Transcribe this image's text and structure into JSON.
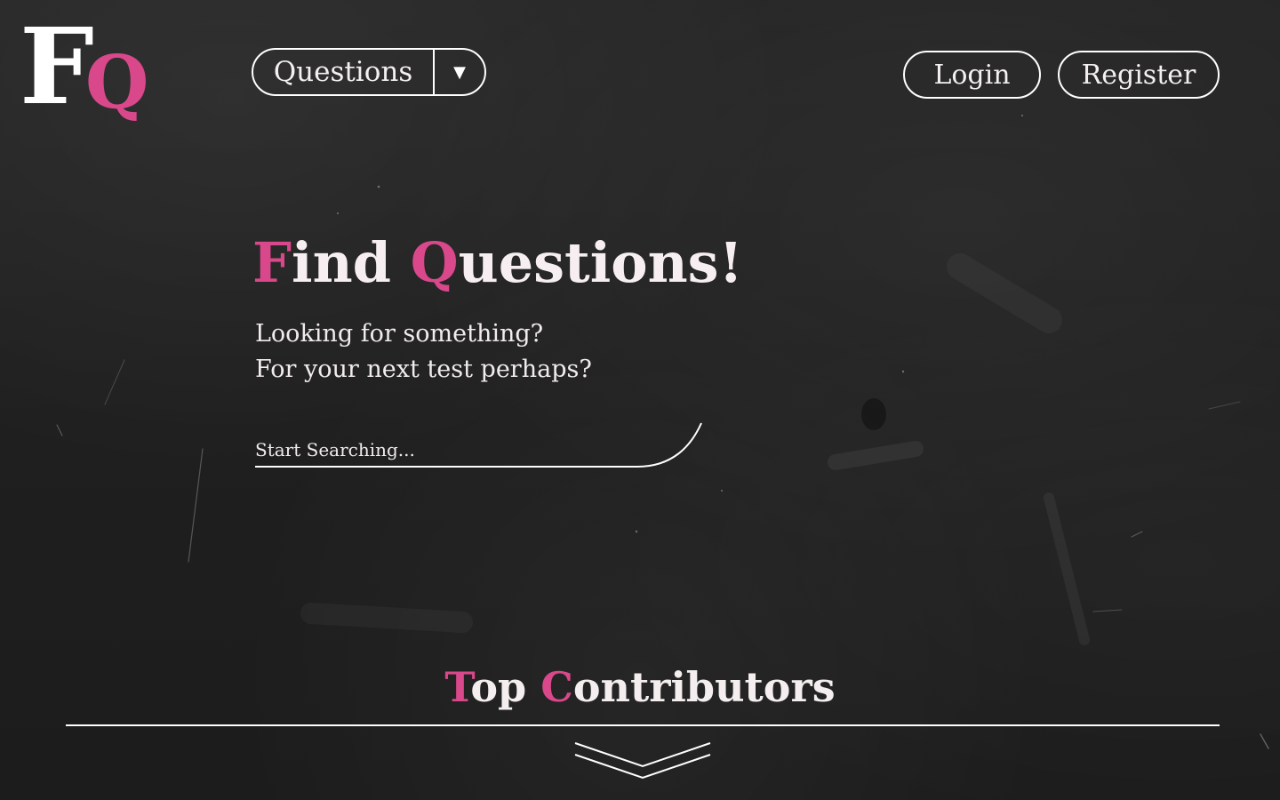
{
  "logo": {
    "letter_f": "F",
    "letter_q": "Q"
  },
  "nav": {
    "questions_label": "Questions",
    "dropdown_icon": "triangle-down-icon",
    "caret": "▼"
  },
  "auth": {
    "login_label": "Login",
    "register_label": "Register"
  },
  "hero": {
    "title_letter_1": "F",
    "title_rest_1": "ind ",
    "title_letter_2": "Q",
    "title_rest_2": "uestions!",
    "subtitle_line_1": "Looking for something?",
    "subtitle_line_2": "For your next test perhaps?"
  },
  "search": {
    "placeholder": "Start Searching...",
    "value": ""
  },
  "contributors": {
    "title_letter_1": "T",
    "title_rest_1": "op ",
    "title_letter_2": "C",
    "title_rest_2": "ontributors",
    "expand_icon": "chevron-down-icon"
  },
  "colors": {
    "background": "#222222",
    "accent": "#d9488b",
    "text": "#f2ecec",
    "outline": "#ffffff"
  }
}
